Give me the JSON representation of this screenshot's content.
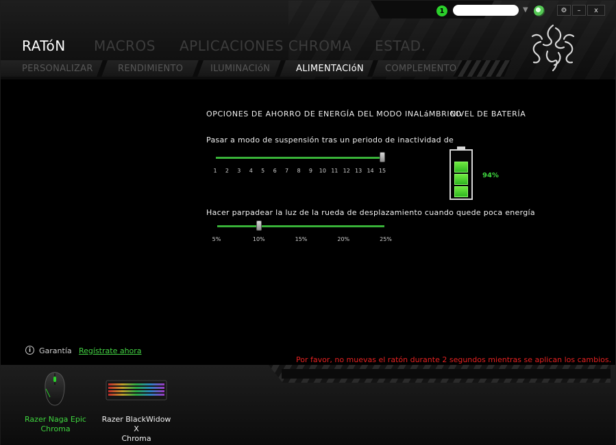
{
  "window": {
    "notification_count": "1",
    "user_name": "",
    "controls": [
      "⚙",
      "–",
      "x"
    ]
  },
  "main_tabs": [
    {
      "label": "RATóN",
      "active": true
    },
    {
      "label": "MACROS",
      "active": false
    },
    {
      "label": "APLICACIONES CHROMA",
      "active": false
    },
    {
      "label": "ESTAD.",
      "active": false
    }
  ],
  "sub_tabs": [
    {
      "label": "PERSONALIZAR",
      "active": false
    },
    {
      "label": "RENDIMIENTO",
      "active": false
    },
    {
      "label": "ILUMINACIóN",
      "active": false
    },
    {
      "label": "ALIMENTACIóN",
      "active": true
    },
    {
      "label": "COMPLEMENTO",
      "active": false
    }
  ],
  "power": {
    "wireless_title": "OPCIONES DE AHORRO DE ENERGÍA DEL MODO INALáMBRICO",
    "battery_title": "NIVEL DE BATERÍA",
    "sleep": {
      "label": "Pasar a modo de suspensión tras un periodo de inactividad de",
      "ticks": [
        "1",
        "2",
        "3",
        "4",
        "5",
        "6",
        "7",
        "8",
        "9",
        "10",
        "11",
        "12",
        "13",
        "14",
        "15"
      ],
      "value": 15,
      "min": 1,
      "max": 15
    },
    "low_power": {
      "label": "Hacer parpadear la luz de la rueda de desplazamiento cuando quede poca energía",
      "ticks": [
        "5%",
        "10%",
        "15%",
        "20%",
        "25%"
      ],
      "value": 10,
      "min": 5,
      "max": 25
    },
    "battery_percent": "94%",
    "battery_cells_filled": 3,
    "battery_color": "#3fd73f"
  },
  "footer": {
    "warranty_label": "Garantía",
    "register_link": "Regístrate ahora",
    "warning": "Por favor, no muevas el ratón durante 2 segundos mientras se aplican los cambios."
  },
  "devices": [
    {
      "name": "Razer Naga Epic\nChroma",
      "active": true,
      "icon": "mouse-icon"
    },
    {
      "name": "Razer BlackWidow X\nChroma",
      "active": false,
      "icon": "keyboard-icon"
    }
  ],
  "colors": {
    "accent_green": "#3fd73f",
    "warning_red": "#e62121",
    "inactive_tab": "#3c3c3c"
  }
}
